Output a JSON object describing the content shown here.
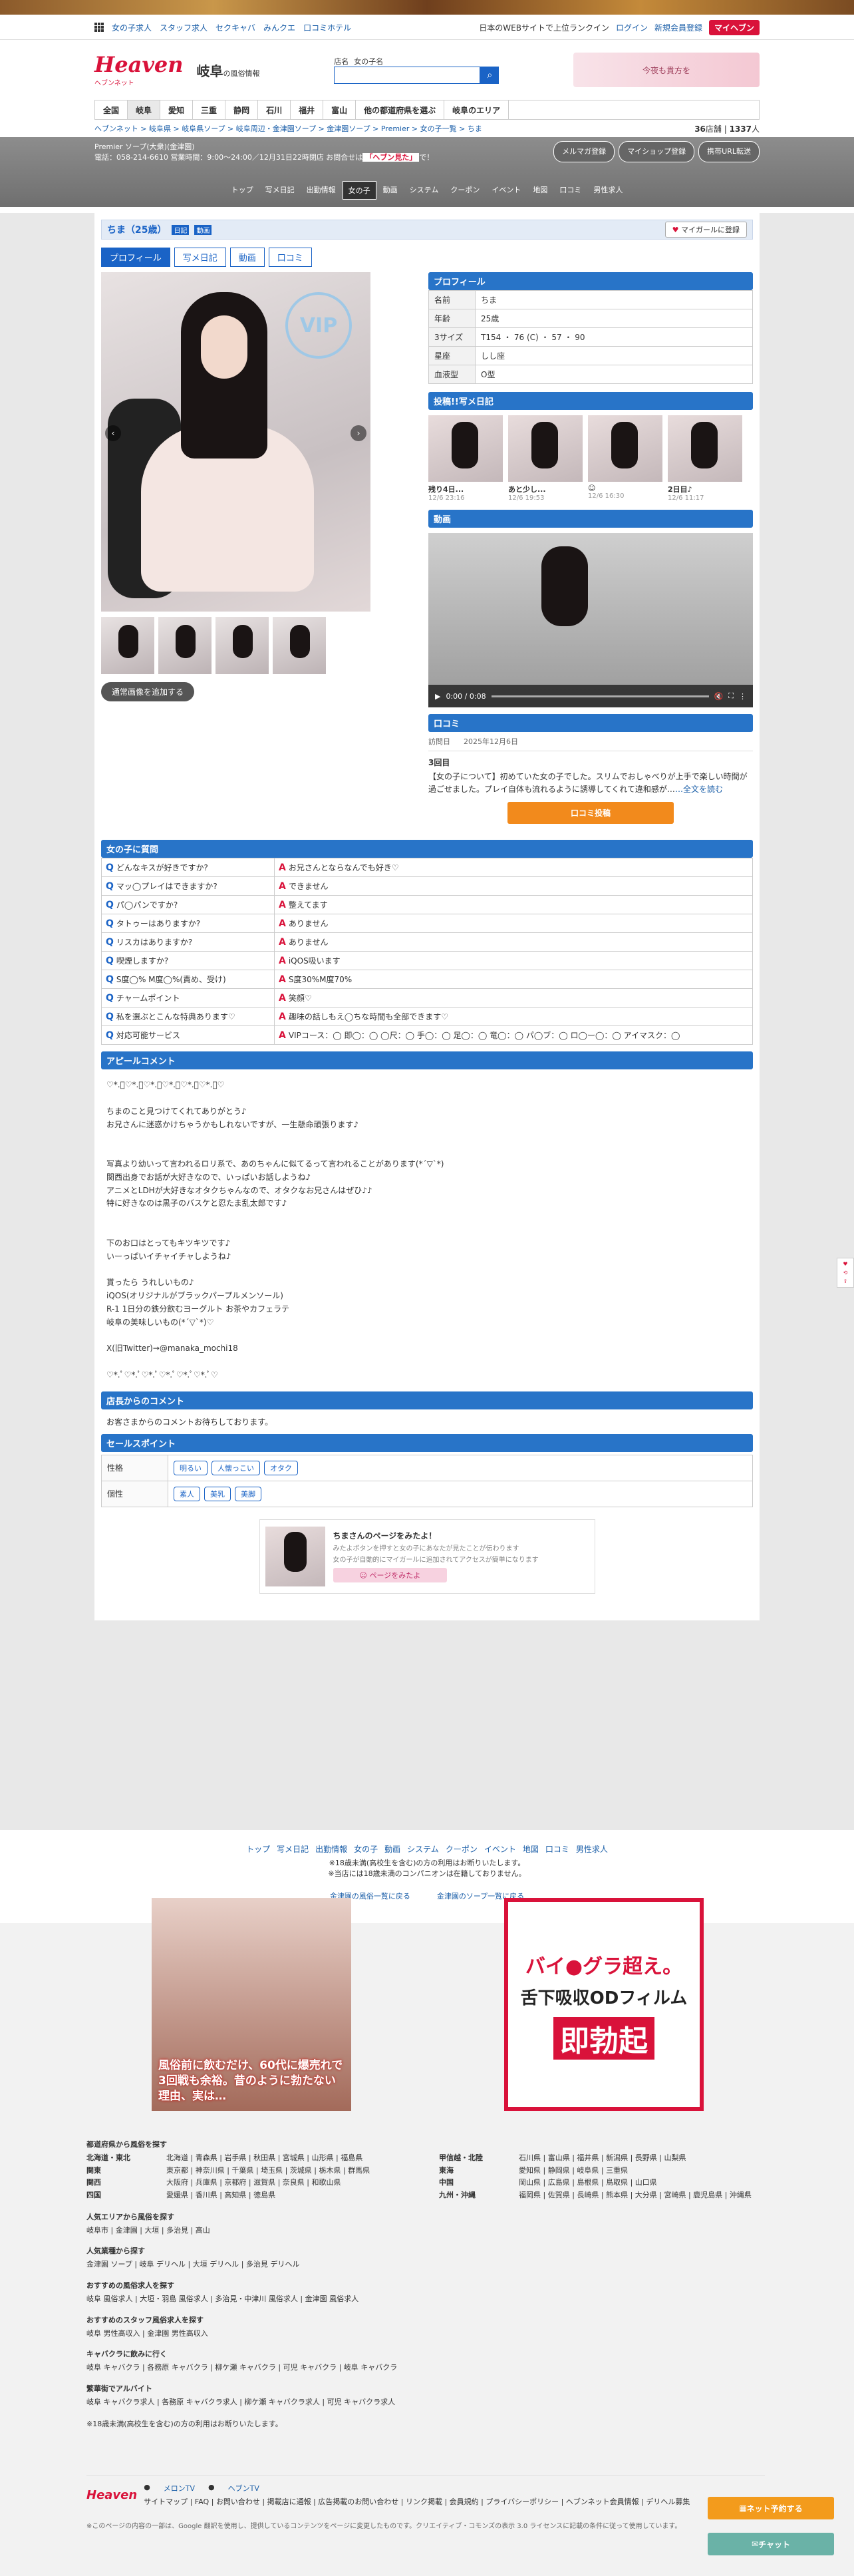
{
  "topbar": {
    "items": [
      "女の子求人",
      "スタッフ求人",
      "セクキャバ",
      "みんクエ",
      "口コミホテル"
    ],
    "tagline": "日本のWEBサイトで上位ランクイン",
    "login": "ログイン",
    "register": "新規会員登録",
    "myheaven": "マイヘブン"
  },
  "header": {
    "logo": "Heaven",
    "logo_sub": "ヘブンネット",
    "area": "岐阜",
    "area_sub": "の風俗情報",
    "search_labels": [
      "店名",
      "女の子名"
    ],
    "search_placeholder": "",
    "banner": "今夜も貴方を"
  },
  "prefs": [
    "全国",
    "岐阜",
    "愛知",
    "三重",
    "静岡",
    "石川",
    "福井",
    "富山",
    "他の都道府県を選ぶ",
    "岐阜のエリア"
  ],
  "breadcrumb": "ヘブンネット > 岐阜県 > 岐阜県ソープ > 岐阜周辺・金津園ソープ > 金津園ソープ > Premier > 女の子一覧 > ちま",
  "counts": {
    "shops": "36",
    "shops_unit": "店舗",
    "girls": "1337",
    "girls_unit": "人"
  },
  "shop": {
    "name": "Premier ソープ(大衆)(金津園)",
    "info": "電話：058-214-6610 営業時間：9:00〜24:00／12月31日22時閉店 お問合せは",
    "highlight": "「ヘブン見た」",
    "info2": "で！",
    "btns": [
      "メルマガ登録",
      "マイショップ登録",
      "携帯URL転送"
    ]
  },
  "shopnav": [
    "トップ",
    "写メ日記",
    "出勤情報",
    "女の子",
    "動画",
    "システム",
    "クーポン",
    "イベント",
    "地図",
    "口コミ",
    "男性求人"
  ],
  "girl": {
    "name": "ちま（25歳）",
    "tag": "日記",
    "tag2": "動画",
    "fav": "マイガールに登録"
  },
  "tabs": [
    "プロフィール",
    "写メ日記",
    "動画",
    "口コミ"
  ],
  "photo": {
    "vip": "VIP",
    "alt_btn": "通常画像を追加する"
  },
  "profile": {
    "title": "プロフィール",
    "rows": [
      {
        "k": "名前",
        "v": "ちま"
      },
      {
        "k": "年齢",
        "v": "25歳"
      },
      {
        "k": "3サイズ",
        "v": "T154 ・ 76 (C) ・ 57 ・ 90"
      },
      {
        "k": "星座",
        "v": "しし座"
      },
      {
        "k": "血液型",
        "v": "O型"
      }
    ]
  },
  "diary": {
    "title": "投稿!!写メ日記",
    "items": [
      {
        "t": "残り4日...",
        "d": "12/6 23:16"
      },
      {
        "t": "あと少し...",
        "d": "12/6 19:53"
      },
      {
        "t": "☺",
        "d": "12/6 16:30"
      },
      {
        "t": "2日目♪",
        "d": "12/6 11:17"
      }
    ]
  },
  "video": {
    "title": "動画",
    "time": "0:00 / 0:08"
  },
  "kuchikomi": {
    "title": "口コミ",
    "date_label": "訪問日",
    "date": "2025年12月6日",
    "heading": "3回目",
    "text": "【女の子について】初めていた女の子でした。スリムでおしゃべりが上手で楽しい時間が過ごせました。プレイ自体も流れるように誘導してくれて違和感が…",
    "more": "…全文を読む",
    "btn": "口コミ投稿"
  },
  "qa": {
    "title": "女の子に質問",
    "rows": [
      {
        "q": "どんなキスが好きですか?",
        "a": "お兄さんとならなんでも好き♡"
      },
      {
        "q": "マッ◯プレイはできますか?",
        "a": "できません"
      },
      {
        "q": "パ◯パンですか?",
        "a": "整えてます"
      },
      {
        "q": "タトゥーはありますか?",
        "a": "ありません"
      },
      {
        "q": "リスカはありますか?",
        "a": "ありません"
      },
      {
        "q": "喫煙しますか?",
        "a": "iQOS吸います"
      },
      {
        "q": "S度◯% M度◯%(責め、受け)",
        "a": "S度30%M度70%"
      },
      {
        "q": "チャームポイント",
        "a": "笑顔♡"
      },
      {
        "q": "私を選ぶとこんな特典あります♡",
        "a": "趣味の話しもえ◯ちな時間も全部できます♡"
      },
      {
        "q": "対応可能サービス",
        "a": "VIPコース：◯ 即◯：◯ ◯尺：◯ 手◯：◯ 足◯：◯ 竜◯：◯ パ◯ブ：◯ ロ◯ー◯：◯ アイマスク：◯"
      }
    ]
  },
  "appeal": {
    "title": "アピールコメント",
    "text": "♡*.ﾟ♡*.ﾟ♡*.ﾟ♡*.ﾟ♡*.ﾟ♡*.ﾟ♡\n\nちまのこと見つけてくれてありがとう♪\nお兄さんに迷惑かけちゃうかもしれないですが、一生懸命頑張ります♪\n\n\n写真より幼いって言われるロリ系で、あのちゃんに似てるって言われることがあります(*´▽`*)\n関西出身でお話が大好きなので、いっぱいお話しようね♪\nアニメとLDHが大好きなオタクちゃんなので、オタクなお兄さんはぜひ♪♪\n特に好きなのは黒子のバスケと忍たま乱太郎です♪\n\n\n下のお口はとってもキツキツです♪\nいーっぱいイチャイチャしようね♪\n\n貰ったら うれしいもの♪\niQOS(オリジナルがブラックパープルメンソール)\nR-1 1日分の鉄分飲むヨーグルト お茶やカフェラテ\n岐阜の美味しいもの(*´▽`*)♡\n\nX(旧Twitter)→@manaka_mochi18\n\n♡*.ﾟ♡*.ﾟ♡*.ﾟ♡*.ﾟ♡*.ﾟ♡*.ﾟ♡"
  },
  "shop_comment": {
    "title": "店長からのコメント",
    "text": "お客さまからのコメントお待ちしております。"
  },
  "sales": {
    "title": "セールスポイント",
    "rows": [
      {
        "k": "性格",
        "v": [
          "明るい",
          "人懐っこい",
          "オタク"
        ]
      },
      {
        "k": "個性",
        "v": [
          "素人",
          "美乳",
          "美脚"
        ]
      }
    ]
  },
  "cta": {
    "t1": "ちまさんのページをみたよ！",
    "t2": "みたよボタンを押すと女の子にあなたが見たことが伝わります",
    "t3": "女の子が自動的にマイガールに追加されてアクセスが簡単になります",
    "btn": "ページをみたよ"
  },
  "footer": {
    "links": [
      "トップ",
      "写メ日記",
      "出勤情報",
      "女の子",
      "動画",
      "システム",
      "クーポン",
      "イベント",
      "地図",
      "口コミ",
      "男性求人"
    ],
    "note1": "※18歳未満(高校生を含む)の方の利用はお断りいたします。",
    "note2": "※当店には18歳未満のコンパニオンは在籍しておりません。",
    "back1": "金津園の風俗一覧に戻る",
    "back2": "金津園のソープ一覧に戻る"
  },
  "ads": {
    "ad1": "風俗前に飲むだけ、60代に爆売れで3回戦も余裕。昔のように勃たない理由、実は…",
    "ad2a": "バイ●グラ超え。",
    "ad2b": "舌下吸収ODフィルム",
    "ad2c": "即勃起"
  },
  "flist": {
    "h1": "都道府県から風俗を探す",
    "regions": [
      {
        "k": "北海道・東北",
        "v": "北海道 | 青森県 | 岩手県 | 秋田県 | 宮城県 | 山形県 | 福島県"
      },
      {
        "k": "関東",
        "v": "東京都 | 神奈川県 | 千葉県 | 埼玉県 | 茨城県 | 栃木県 | 群馬県"
      },
      {
        "k": "関西",
        "v": "大阪府 | 兵庫県 | 京都府 | 滋賀県 | 奈良県 | 和歌山県"
      },
      {
        "k": "四国",
        "v": "愛媛県 | 香川県 | 高知県 | 徳島県"
      }
    ],
    "regions2": [
      {
        "k": "甲信越・北陸",
        "v": "石川県 | 富山県 | 福井県 | 新潟県 | 長野県 | 山梨県"
      },
      {
        "k": "東海",
        "v": "愛知県 | 静岡県 | 岐阜県 | 三重県"
      },
      {
        "k": "中国",
        "v": "岡山県 | 広島県 | 島根県 | 鳥取県 | 山口県"
      },
      {
        "k": "九州・沖縄",
        "v": "福岡県 | 佐賀県 | 長崎県 | 熊本県 | 大分県 | 宮崎県 | 鹿児島県 | 沖縄県"
      }
    ],
    "h2": "人気エリアから風俗を探す",
    "l2": "岐阜市 | 金津園 | 大垣 | 多治見 | 高山",
    "h3": "人気業種から探す",
    "l3": "金津園 ソープ | 岐阜 デリヘル | 大垣 デリヘル | 多治見 デリヘル",
    "h4": "おすすめの風俗求人を探す",
    "l4": "岐阜 風俗求人 | 大垣・羽島 風俗求人 | 多治見・中津川 風俗求人 | 金津園 風俗求人",
    "h5": "おすすめのスタッフ風俗求人を探す",
    "l5": "岐阜 男性高収入 | 金津園 男性高収入",
    "h6": "キャバクラに飲みに行く",
    "l6": "岐阜 キャバクラ | 各務原 キャバクラ | 柳ケ瀬 キャバクラ | 可児 キャバクラ | 岐阜 キャバクラ",
    "h7": "繁華街でアルバイト",
    "l7": "岐阜 キャバクラ求人 | 各務原 キャバクラ求人 | 柳ケ瀬 キャバクラ求人 | 可児 キャバクラ求人",
    "note": "※18歳未満(高校生を含む)の方の利用はお断りいたします。"
  },
  "fbar": {
    "logo": "Heaven",
    "tv1": "メロンTV",
    "tv2": "ヘブンTV",
    "links": "サイトマップ | FAQ | お問い合わせ | 掲載店に通報 | 広告掲載のお問い合わせ | リンク掲載 | 会員規約 | プライバシーポリシー | ヘブンネット会員情報 | デリヘル募集",
    "copy": "※このページの内容の一部は、Google 翻訳を使用し、提供しているコンテンツをページに変更したものです。クリエイティブ・コモンズの表示 3.0 ライセンスに記載の条件に従って使用しています。"
  },
  "floats": {
    "f1": "ネット予約する",
    "f2": "チャット"
  }
}
